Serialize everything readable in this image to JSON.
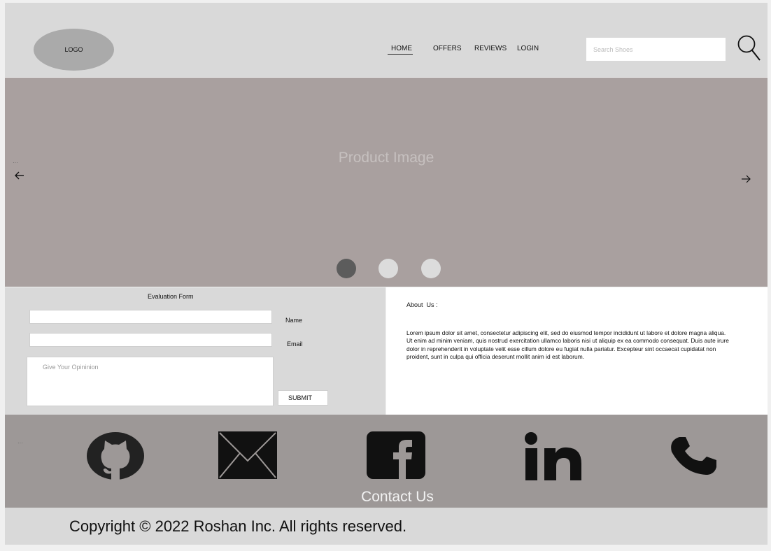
{
  "header": {
    "logo_text": "LOGO",
    "nav": [
      "HOME",
      "OFFERS",
      "REVIEWS",
      "LOGIN"
    ],
    "active_nav": "HOME",
    "search_placeholder": "Search Shoes"
  },
  "carousel": {
    "placeholder": "Product Image",
    "slides": 3,
    "active_slide": 1,
    "dot_colors": [
      "#5c5c5c",
      "#dcdcdc",
      "#dcdcdc"
    ]
  },
  "form": {
    "title": "Evaluation Form",
    "name_label": "Name",
    "email_label": "Email",
    "opinion_placeholder": "Give Your Opininion",
    "submit_label": "SUBMIT"
  },
  "about": {
    "title": "About  Us :",
    "body": "Lorem ipsum dolor sit amet, consectetur adipiscing elit, sed do eiusmod tempor incididunt ut labore et dolore magna aliqua. Ut enim ad minim veniam, quis nostrud exercitation ullamco laboris nisi ut aliquip ex ea commodo consequat. Duis aute irure dolor in reprehenderit in voluptate velit esse cillum dolore eu fugiat nulla pariatur. Excepteur sint occaecat cupidatat non proident, sunt in culpa qui officia deserunt mollit anim id est laborum."
  },
  "contact": {
    "title": "Contact Us",
    "icons": [
      "github-icon",
      "mail-icon",
      "facebook-icon",
      "linkedin-icon",
      "phone-icon"
    ]
  },
  "footer": {
    "copyright": "Copyright © 2022 Roshan Inc. All rights reserved."
  },
  "colors": {
    "header_bg": "#d9d9d9",
    "carousel_bg": "#a9a09f",
    "contact_bg": "#9d9897"
  }
}
